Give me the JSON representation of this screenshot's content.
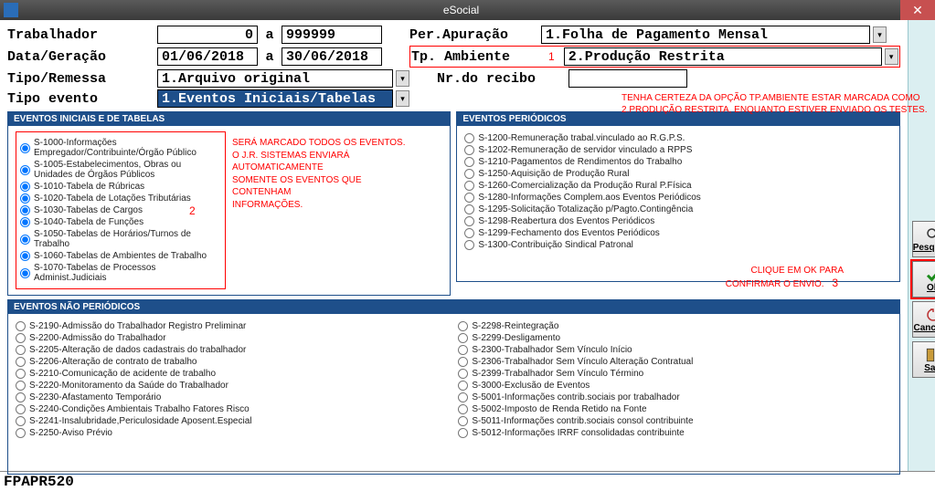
{
  "window": {
    "title": "eSocial"
  },
  "form": {
    "labels": {
      "trabalhador": "Trabalhador",
      "a": "a",
      "data_geracao": "Data/Geração",
      "tipo_remessa": "Tipo/Remessa",
      "tipo_evento": "Tipo evento",
      "per_apuracao": "Per.Apuração",
      "tp_ambiente": "Tp. Ambiente",
      "nr_recibo": "Nr.do recibo"
    },
    "values": {
      "trabalhador_de": "0",
      "trabalhador_a": "999999",
      "data_de": "01/06/2018",
      "data_a": "30/06/2018",
      "tipo_remessa": "1.Arquivo original",
      "tipo_evento": "1.Eventos Iniciais/Tabelas",
      "per_apuracao": "1.Folha de Pagamento Mensal",
      "tp_ambiente": "2.Produção Restrita",
      "nr_recibo": ""
    }
  },
  "annotations": {
    "num1": "1",
    "num2": "2",
    "num3": "3",
    "tp_ambiente_line1": "TENHA CERTEZA DA OPÇÃO TP.AMBIENTE ESTAR MARCADA COMO",
    "tp_ambiente_line2": "2.PRODUÇÃO RESTRITA, ENQUANTO ESTIVER ENVIADO OS TESTES.",
    "eventos_line1": "SERÁ MARCADO TODOS OS EVENTOS.",
    "eventos_line2": "O J.R. SISTEMAS ENVIARÁ",
    "eventos_line3": "AUTOMATICAMENTE",
    "eventos_line4": "SOMENTE OS EVENTOS QUE CONTENHAM",
    "eventos_line5": "INFORMAÇÕES.",
    "ok_line1": "CLIQUE EM OK PARA",
    "ok_line2": "CONFIRMAR O ENVIO."
  },
  "groups": {
    "iniciais_title": "EVENTOS INICIAIS E DE TABELAS",
    "periodicos_title": "EVENTOS PERIÓDICOS",
    "nao_periodicos_title": "EVENTOS NÃO PERIÓDICOS",
    "iniciais": [
      "S-1000-Informações Empregador/Contribuinte/Órgão Público",
      "S-1005-Estabelecimentos, Obras ou Unidades de Órgãos Públicos",
      "S-1010-Tabela de Rúbricas",
      "S-1020-Tabela de Lotações Tributárias",
      "S-1030-Tabelas de Cargos",
      "S-1040-Tabela de Funções",
      "S-1050-Tabelas de Horários/Turnos de Trabalho",
      "S-1060-Tabelas de Ambientes de Trabalho",
      "S-1070-Tabelas de Processos Administ.Judiciais"
    ],
    "periodicos": [
      "S-1200-Remuneração trabal.vinculado ao R.G.P.S.",
      "S-1202-Remuneração de servidor vinculado a RPPS",
      "S-1210-Pagamentos de Rendimentos do Trabalho",
      "S-1250-Aquisição de Produção Rural",
      "S-1260-Comercialização da Produção Rural P.Física",
      "S-1280-Informações Complem.aos Eventos Periódicos",
      "S-1295-Solicitação Totalização p/Pagto.Contingência",
      "S-1298-Reabertura dos Eventos Periódicos",
      "S-1299-Fechamento dos Eventos Periódicos",
      "S-1300-Contribuição Sindical Patronal"
    ],
    "nao_periodicos_col1": [
      "S-2190-Admissão do Trabalhador Registro Preliminar",
      "S-2200-Admissão do Trabalhador",
      "S-2205-Alteração de dados cadastrais do trabalhador",
      "S-2206-Alteração de contrato de trabalho",
      "S-2210-Comunicação de acidente de trabalho",
      "S-2220-Monitoramento da Saúde do Trabalhador",
      "S-2230-Afastamento Temporário",
      "S-2240-Condições Ambientais Trabalho Fatores Risco",
      "S-2241-Insalubridade,Periculosidade Aposent.Especial",
      "S-2250-Aviso Prévio"
    ],
    "nao_periodicos_col2": [
      "S-2298-Reintegração",
      "S-2299-Desligamento",
      "S-2300-Trabalhador Sem Vínculo Início",
      "S-2306-Trabalhador Sem Vínculo Alteração Contratual",
      "S-2399-Trabalhador Sem Vínculo Término",
      "S-3000-Exclusão de Eventos",
      "S-5001-Informações contrib.sociais por trabalhador",
      "S-5002-Imposto de Renda Retido na Fonte",
      "S-5011-Informações contrib.sociais consol contribuinte",
      "S-5012-Informações IRRF consolidadas contribuinte"
    ]
  },
  "buttons": {
    "pesquisa": "Pesquisa",
    "ok": "Ok",
    "cancelar": "Cancelar",
    "sair": "Sair"
  },
  "statusbar": "FPAPR520"
}
